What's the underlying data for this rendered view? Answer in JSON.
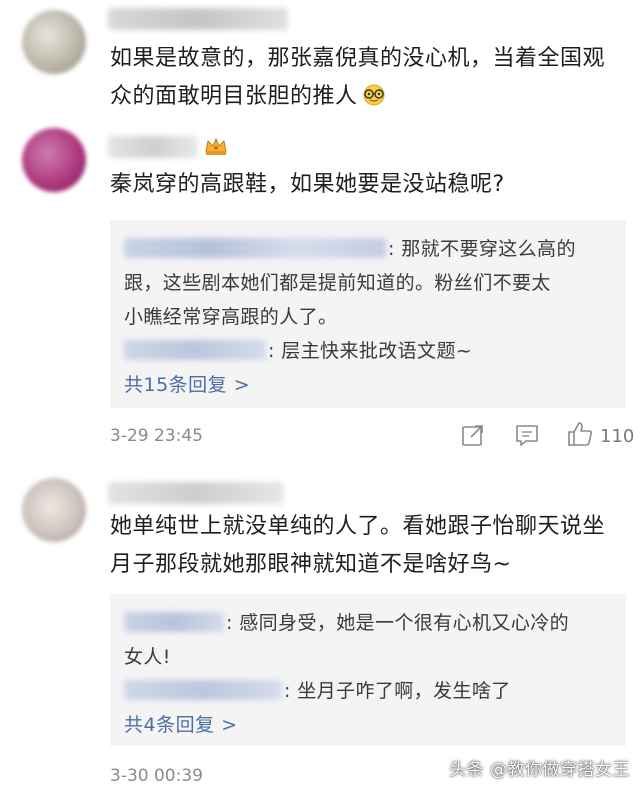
{
  "comments": [
    {
      "text_line1": "如果是故意的，那张嘉倪真的没心机，当着全国观",
      "text_line2": "众的面敢明目张胆的推人",
      "emoji": "face-with-glasses-emoji",
      "avatar_color": "#c8c2b8"
    },
    {
      "text": "秦岚穿的高跟鞋，如果她要是没站稳呢?",
      "avatar_color": "#b24a8c",
      "badge": "crown-icon",
      "replies": [
        {
          "line1": ": 那就不要穿这么高的",
          "line2": "跟，这些剧本她们都是提前知道的。粉丝们不要太",
          "line3": "小瞧经常穿高跟的人了。"
        },
        {
          "line1": ": 层主快来批改语文题~"
        }
      ],
      "more_replies": "共15条回复 >",
      "time": "3-29 23:45",
      "likes": "110"
    },
    {
      "text_line1": "她单纯世上就没单纯的人了。看她跟子怡聊天说坐",
      "text_line2": "月子那段就她那眼神就知道不是啥好鸟~",
      "avatar_color": "#cfc8c4",
      "replies": [
        {
          "line1": ": 感同身受，她是一个很有心机又心冷的",
          "line2": "女人!"
        },
        {
          "line1": ": 坐月子咋了啊，发生啥了"
        }
      ],
      "more_replies": "共4条回复 >",
      "time": "3-30 00:39"
    }
  ],
  "watermark": "头条 @教你做穿搭女王",
  "colors": {
    "link": "#4c6ea8",
    "reply_bg": "#f4f4f5",
    "meta_gray": "#8a8a8a"
  }
}
